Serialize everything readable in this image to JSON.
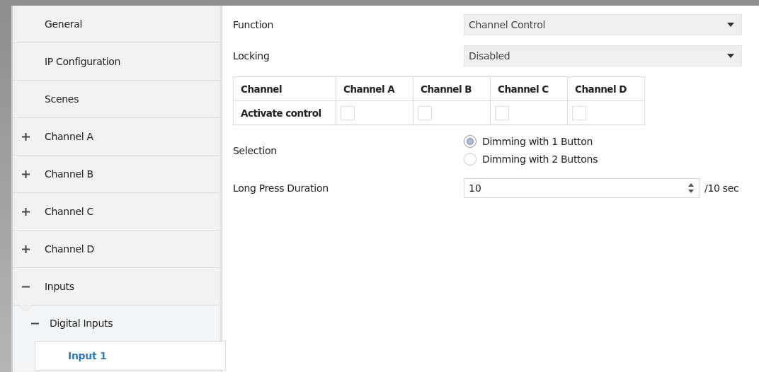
{
  "sidebar": {
    "items": [
      {
        "label": "General",
        "kind": "leaf",
        "selected": false
      },
      {
        "label": "IP Configuration",
        "kind": "leaf",
        "selected": false
      },
      {
        "label": "Scenes",
        "kind": "leaf",
        "selected": false
      },
      {
        "label": "Channel A",
        "kind": "group",
        "expanded": false,
        "selected": false
      },
      {
        "label": "Channel B",
        "kind": "group",
        "expanded": false,
        "selected": false
      },
      {
        "label": "Channel C",
        "kind": "group",
        "expanded": false,
        "selected": false
      },
      {
        "label": "Channel D",
        "kind": "group",
        "expanded": false,
        "selected": false
      },
      {
        "label": "Inputs",
        "kind": "group",
        "expanded": true,
        "selected": false,
        "children": [
          {
            "label": "Digital Inputs",
            "kind": "group",
            "expanded": true,
            "selected": false,
            "children": [
              {
                "label": "Input 1",
                "selected": true
              }
            ]
          }
        ]
      }
    ]
  },
  "form": {
    "function": {
      "label": "Function",
      "value": "Channel Control"
    },
    "locking": {
      "label": "Locking",
      "value": "Disabled"
    },
    "table": {
      "columns": [
        "Channel",
        "Channel A",
        "Channel B",
        "Channel C",
        "Channel D"
      ],
      "rows": [
        {
          "label": "Activate control",
          "cells": [
            {
              "checked": false
            },
            {
              "checked": false
            },
            {
              "checked": false
            },
            {
              "checked": false
            }
          ]
        }
      ]
    },
    "selection": {
      "label": "Selection",
      "options": [
        {
          "label": "Dimming with 1 Button",
          "selected": true
        },
        {
          "label": "Dimming with 2 Buttons",
          "selected": false
        }
      ]
    },
    "long_press": {
      "label": "Long Press Duration",
      "value": "10",
      "unit": "/10 sec"
    }
  }
}
